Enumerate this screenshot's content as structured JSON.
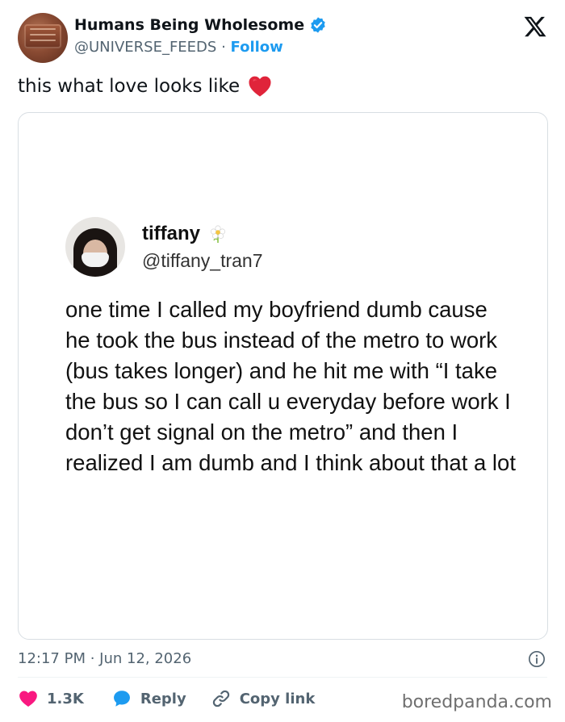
{
  "author": {
    "name": "Humans Being Wholesome",
    "handle": "@UNIVERSE_FEEDS",
    "separator": "·",
    "follow_label": "Follow",
    "verified_icon": "verified-badge-icon",
    "brand_color": "#1d9bf0"
  },
  "tweet": {
    "text": "this what love looks like",
    "emoji": "red-heart-emoji"
  },
  "embedded_post": {
    "name": "tiffany",
    "name_emoji": "flower-emoji",
    "handle": "@tiffany_tran7",
    "body": "one time I called my boyfriend dumb cause he took the bus instead of the metro to work (bus takes longer) and he hit me with “I take the bus so I can call u everyday before work I don’t get signal on the metro” and then I realized I am dumb and I think about that a lot"
  },
  "meta": {
    "timestamp": "12:17 PM · Jun 12, 2026"
  },
  "actions": {
    "likes": "1.3K",
    "reply_label": "Reply",
    "copy_link_label": "Copy link",
    "like_color": "#f91880",
    "reply_color": "#1d9bf0"
  },
  "watermark": "boredpanda.com"
}
